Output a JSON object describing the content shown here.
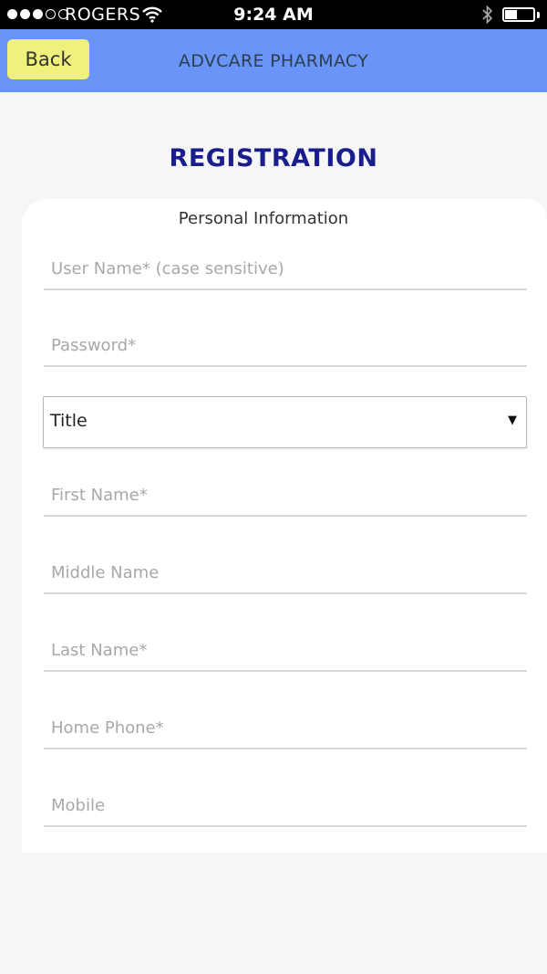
{
  "status_bar": {
    "carrier": "ROGERS",
    "time": "9:24 AM",
    "signal_icon": "signal-dots-icon",
    "wifi_icon": "wifi-icon",
    "bluetooth_icon": "bluetooth-icon",
    "battery_icon": "battery-icon",
    "battery_level": 0.4
  },
  "header": {
    "back_label": "Back",
    "title": "ADVCARE PHARMACY",
    "bar_color": "#6a95f8",
    "back_color": "#f0f07d"
  },
  "page": {
    "title": "REGISTRATION",
    "title_color": "#1a1e8c"
  },
  "form": {
    "section_label": "Personal Information",
    "username": {
      "placeholder": "User Name* (case sensitive)",
      "value": ""
    },
    "password": {
      "placeholder": "Password*",
      "value": ""
    },
    "title_select": {
      "value": "Title",
      "icon": "caret-down-icon"
    },
    "first_name": {
      "placeholder": "First Name*",
      "value": ""
    },
    "middle_name": {
      "placeholder": "Middle Name",
      "value": ""
    },
    "last_name": {
      "placeholder": "Last Name*",
      "value": ""
    },
    "home_phone": {
      "placeholder": "Home Phone*",
      "value": ""
    },
    "mobile": {
      "placeholder": "Mobile",
      "value": ""
    }
  }
}
